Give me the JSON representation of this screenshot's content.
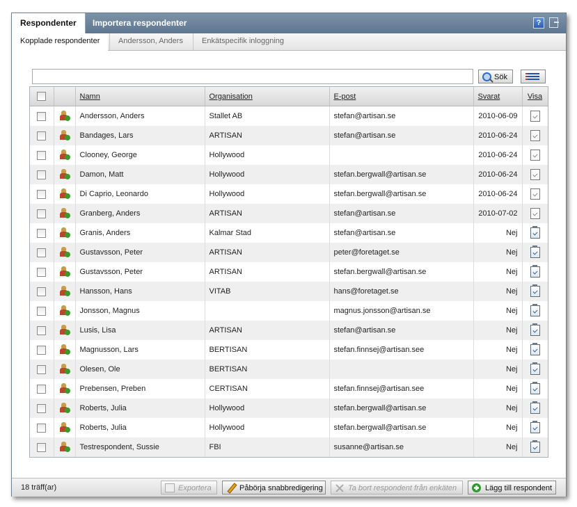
{
  "tabs": {
    "active": "Respondenter",
    "other": "Importera respondenter"
  },
  "window_icons": {
    "help": "?",
    "help_icon": "help-icon",
    "exit_icon": "exit-icon"
  },
  "subtabs": [
    "Kopplade respondenter",
    "Andersson, Anders",
    "Enkätspecifik inloggning"
  ],
  "search": {
    "value": "",
    "button_label": "Sök"
  },
  "columns": {
    "namn": "Namn",
    "organisation": "Organisation",
    "epost": "E-post",
    "svarat": "Svarat",
    "visa": "Visa"
  },
  "rows": [
    {
      "namn": "Andersson, Anders",
      "org": "Stallet AB",
      "epost": "stefan@artisan.se",
      "svarat": "2010-06-09",
      "visa_active": false
    },
    {
      "namn": "Bandages, Lars",
      "org": "ARTISAN",
      "epost": "stefan@artisan.se",
      "svarat": "2010-06-24",
      "visa_active": false
    },
    {
      "namn": "Clooney, George",
      "org": "Hollywood",
      "epost": "",
      "svarat": "2010-06-24",
      "visa_active": false
    },
    {
      "namn": "Damon, Matt",
      "org": "Hollywood",
      "epost": "stefan.bergwall@artisan.se",
      "svarat": "2010-06-24",
      "visa_active": false
    },
    {
      "namn": "Di Caprio, Leonardo",
      "org": "Hollywood",
      "epost": "stefan.bergwall@artisan.se",
      "svarat": "2010-06-24",
      "visa_active": false
    },
    {
      "namn": "Granberg, Anders",
      "org": "ARTISAN",
      "epost": "stefan@artisan.se",
      "svarat": "2010-07-02",
      "visa_active": false
    },
    {
      "namn": "Granis, Anders",
      "org": "Kalmar Stad",
      "epost": "stefan@artisan.se",
      "svarat": "Nej",
      "visa_active": true
    },
    {
      "namn": "Gustavsson, Peter",
      "org": "ARTISAN",
      "epost": "peter@foretaget.se",
      "svarat": "Nej",
      "visa_active": true
    },
    {
      "namn": "Gustavsson, Peter",
      "org": "ARTISAN",
      "epost": "stefan.bergwall@artisan.se",
      "svarat": "Nej",
      "visa_active": true
    },
    {
      "namn": "Hansson, Hans",
      "org": "VITAB",
      "epost": "hans@foretaget.se",
      "svarat": "Nej",
      "visa_active": true
    },
    {
      "namn": "Jonsson, Magnus",
      "org": "",
      "epost": "magnus.jonsson@artisan.se",
      "svarat": "Nej",
      "visa_active": true
    },
    {
      "namn": "Lusis, Lisa",
      "org": "ARTISAN",
      "epost": "stefan@artisan.se",
      "svarat": "Nej",
      "visa_active": true
    },
    {
      "namn": "Magnusson, Lars",
      "org": "BERTISAN",
      "epost": "stefan.finnsej@artisan.see",
      "svarat": "Nej",
      "visa_active": true
    },
    {
      "namn": "Olesen, Ole",
      "org": "BERTISAN",
      "epost": "",
      "svarat": "Nej",
      "visa_active": true
    },
    {
      "namn": "Prebensen, Preben",
      "org": "CERTISAN",
      "epost": "stefan.finnsej@artisan.see",
      "svarat": "Nej",
      "visa_active": true
    },
    {
      "namn": "Roberts, Julia",
      "org": "Hollywood",
      "epost": "stefan.bergwall@artisan.se",
      "svarat": "Nej",
      "visa_active": true
    },
    {
      "namn": "Roberts, Julia",
      "org": "Hollywood",
      "epost": "stefan.bergwall@artisan.se",
      "svarat": "Nej",
      "visa_active": true
    },
    {
      "namn": "Testrespondent, Sussie",
      "org": "FBI",
      "epost": "susanne@artisan.se",
      "svarat": "Nej",
      "visa_active": true
    }
  ],
  "footer": {
    "hits": "18 träff(ar)",
    "export_label": "Exportera",
    "quick_edit_label": "Påbörja snabbredigering",
    "remove_label": "Ta bort respondent från enkäten",
    "add_label": "Lägg till respondent"
  },
  "colors": {
    "titlebar": "#6a8299",
    "row_alt": "#efefef",
    "add_green": "#2f9a2f"
  }
}
